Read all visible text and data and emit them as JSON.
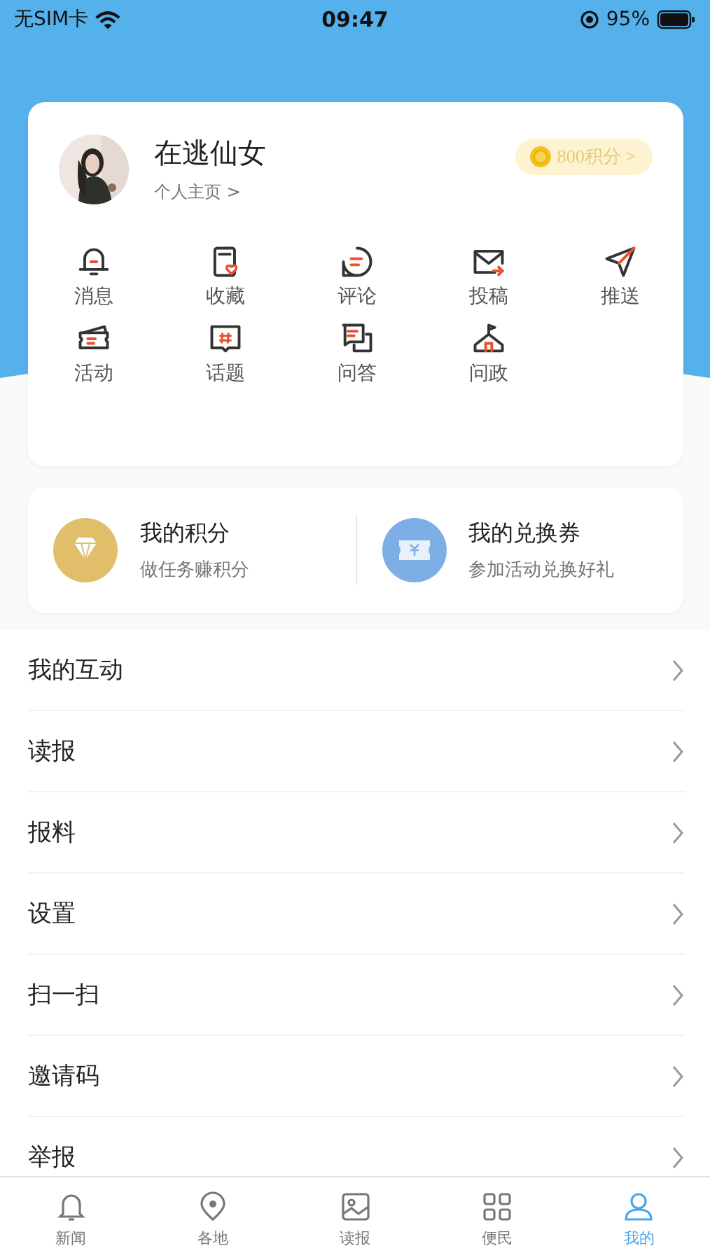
{
  "status_bar": {
    "carrier": "无SIM卡",
    "time": "09:47",
    "battery": "95%"
  },
  "profile": {
    "name": "在逃仙女",
    "link": "个人主页 >",
    "points": "800积分 >"
  },
  "shortcuts": [
    {
      "kind": "bell",
      "label": "消息"
    },
    {
      "kind": "favorite",
      "label": "收藏"
    },
    {
      "kind": "comment",
      "label": "评论"
    },
    {
      "kind": "mail",
      "label": "投稿"
    },
    {
      "kind": "send",
      "label": "推送"
    },
    {
      "kind": "ticket",
      "label": "活动"
    },
    {
      "kind": "topic",
      "label": "话题"
    },
    {
      "kind": "qa",
      "label": "问答"
    },
    {
      "kind": "gov",
      "label": "问政"
    }
  ],
  "rewards": [
    {
      "kind": "points",
      "title": "我的积分",
      "subtitle": "做任务赚积分"
    },
    {
      "kind": "coupon",
      "title": "我的兑换券",
      "subtitle": "参加活动兑换好礼"
    }
  ],
  "menu": [
    "我的互动",
    "读报",
    "报料",
    "设置",
    "扫一扫",
    "邀请码",
    "举报"
  ],
  "tab_bar": [
    {
      "kind": "news",
      "label": "新闻",
      "selected": false
    },
    {
      "kind": "local",
      "label": "各地",
      "selected": false
    },
    {
      "kind": "paper",
      "label": "读报",
      "selected": false
    },
    {
      "kind": "service",
      "label": "便民",
      "selected": false
    },
    {
      "kind": "me",
      "label": "我的",
      "selected": true
    }
  ]
}
